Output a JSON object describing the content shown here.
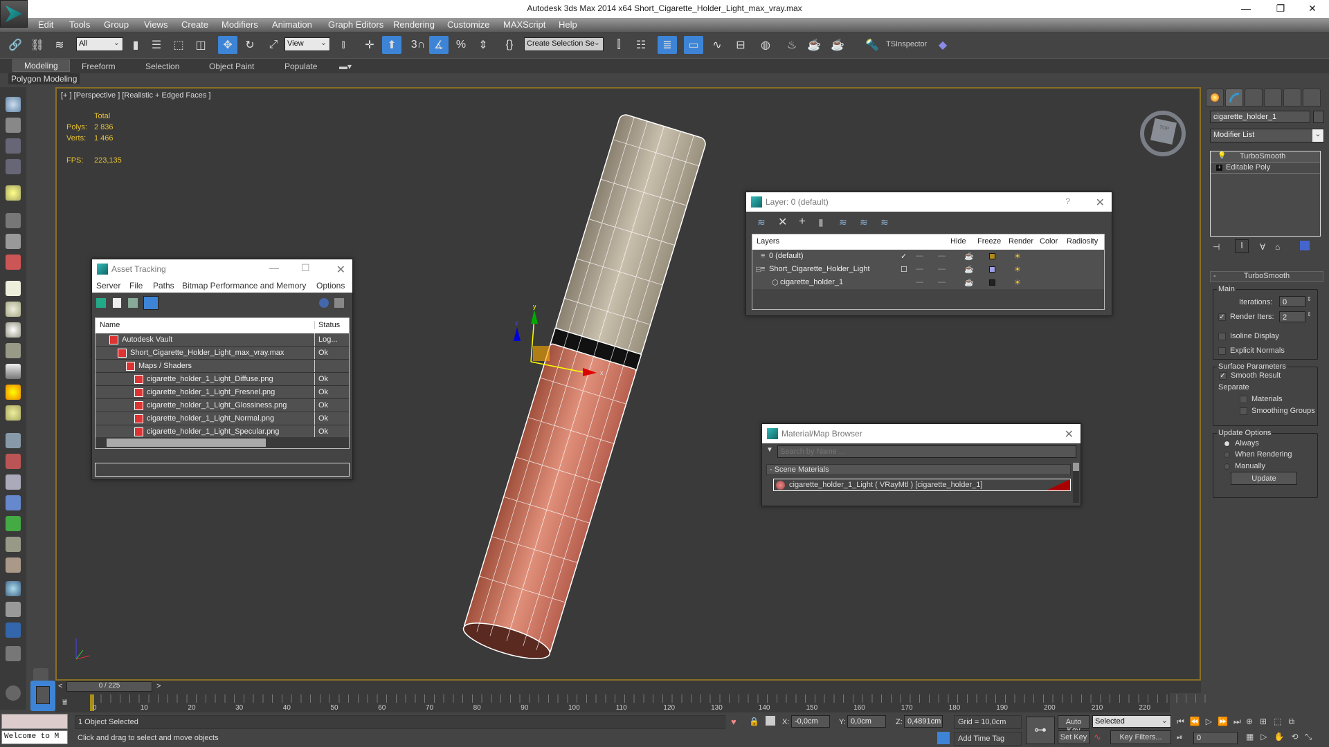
{
  "window": {
    "title": "Autodesk 3ds Max  2014 x64      Short_Cigarette_Holder_Light_max_vray.max",
    "controls": [
      "—",
      "❐",
      "✕"
    ]
  },
  "menu": [
    "Edit",
    "Tools",
    "Group",
    "Views",
    "Create",
    "Modifiers",
    "Animation",
    "Graph Editors",
    "Rendering",
    "Customize",
    "MAXScript",
    "Help"
  ],
  "toolbar": {
    "selection_filter": "All",
    "ref_coord": "View",
    "named_selection": "Create Selection Se",
    "tsinspector": "TSInspector"
  },
  "ribbon": {
    "tabs": [
      "Modeling",
      "Freeform",
      "Selection",
      "Object Paint",
      "Populate"
    ],
    "active_tab": "Modeling",
    "sub_label": "Polygon Modeling"
  },
  "viewport": {
    "label": "[+ ] [Perspective ] [Realistic + Edged Faces ]",
    "stats": {
      "total_label": "Total",
      "polys_label": "Polys:",
      "polys": "2 836",
      "verts_label": "Verts:",
      "verts": "1 466",
      "fps_label": "FPS:",
      "fps": "223,135"
    },
    "viewcube_label": "TOP",
    "gizmo_axes": [
      "x",
      "y",
      "z"
    ]
  },
  "asset_tracking": {
    "title": "Asset Tracking",
    "menu": [
      "Server",
      "File",
      "Paths",
      "Bitmap Performance and Memory",
      "Options"
    ],
    "columns": [
      "Name",
      "Status"
    ],
    "rows": [
      {
        "name": "Autodesk Vault",
        "status": "Log...",
        "level": 1,
        "icon": "vault-icon"
      },
      {
        "name": "Short_Cigarette_Holder_Light_max_vray.max",
        "status": "Ok",
        "level": 2,
        "icon": "max-file-icon"
      },
      {
        "name": "Maps / Shaders",
        "status": "",
        "level": 3,
        "icon": "maps-icon"
      },
      {
        "name": "cigarette_holder_1_Light_Diffuse.png",
        "status": "Ok",
        "level": 4,
        "icon": "bitmap-icon"
      },
      {
        "name": "cigarette_holder_1_Light_Fresnel.png",
        "status": "Ok",
        "level": 4,
        "icon": "bitmap-icon"
      },
      {
        "name": "cigarette_holder_1_Light_Glossiness.png",
        "status": "Ok",
        "level": 4,
        "icon": "bitmap-icon"
      },
      {
        "name": "cigarette_holder_1_Light_Normal.png",
        "status": "Ok",
        "level": 4,
        "icon": "bitmap-icon"
      },
      {
        "name": "cigarette_holder_1_Light_Specular.png",
        "status": "Ok",
        "level": 4,
        "icon": "bitmap-icon"
      }
    ]
  },
  "layer_dialog": {
    "title": "Layer: 0 (default)",
    "help": "?",
    "columns": [
      "Layers",
      "",
      "Hide",
      "Freeze",
      "Render",
      "Color",
      "Radiosity"
    ],
    "rows": [
      {
        "name": "0 (default)",
        "current": "✓",
        "color": "#b08a1a"
      },
      {
        "name": "Short_Cigarette_Holder_Light",
        "current": "☐",
        "color": "#a0a0e8"
      },
      {
        "name": "cigarette_holder_1",
        "current": "",
        "color": "#222222"
      }
    ]
  },
  "material_browser": {
    "title": "Material/Map Browser",
    "search_placeholder": "Search by Name ...",
    "section": "- Scene Materials",
    "item": "cigarette_holder_1_Light  ( VRayMtl ) [cigarette_holder_1]"
  },
  "command_panel": {
    "object_name": "cigarette_holder_1",
    "modifier_list": "Modifier List",
    "stack": [
      "TurboSmooth",
      "Editable Poly"
    ],
    "rollout_title": "TurboSmooth",
    "main_group": "Main",
    "iterations_label": "Iterations:",
    "iterations": "0",
    "render_iters_label": "Render Iters:",
    "render_iters": "2",
    "render_iters_checked": true,
    "isoline_label": "Isoline Display",
    "explicit_normals_label": "Explicit Normals",
    "surface_group": "Surface Parameters",
    "smooth_result_label": "Smooth Result",
    "separate_label": "Separate",
    "materials_label": "Materials",
    "smoothing_groups_label": "Smoothing Groups",
    "update_group": "Update Options",
    "always_label": "Always",
    "when_rendering_label": "When Rendering",
    "manually_label": "Manually",
    "update_button": "Update"
  },
  "timeline": {
    "frame": "0 / 225",
    "ticks": [
      "0",
      "10",
      "20",
      "30",
      "40",
      "50",
      "60",
      "70",
      "80",
      "90",
      "100",
      "110",
      "120",
      "130",
      "140",
      "150",
      "160",
      "170",
      "180",
      "190",
      "200",
      "210",
      "220"
    ]
  },
  "status": {
    "maxscript": "Welcome to M",
    "selected": "1 Object Selected",
    "prompt": "Click and drag to select and move objects",
    "x_label": "X:",
    "x": "-0,0cm",
    "y_label": "Y:",
    "y": "0,0cm",
    "z_label": "Z:",
    "z": "0,4891cm",
    "grid": "Grid = 10,0cm",
    "add_time_tag": "Add Time Tag",
    "auto_key": "Auto Key",
    "set_key": "Set Key",
    "key_mode": "Selected",
    "key_filters": "Key Filters...",
    "current_frame": "0"
  }
}
